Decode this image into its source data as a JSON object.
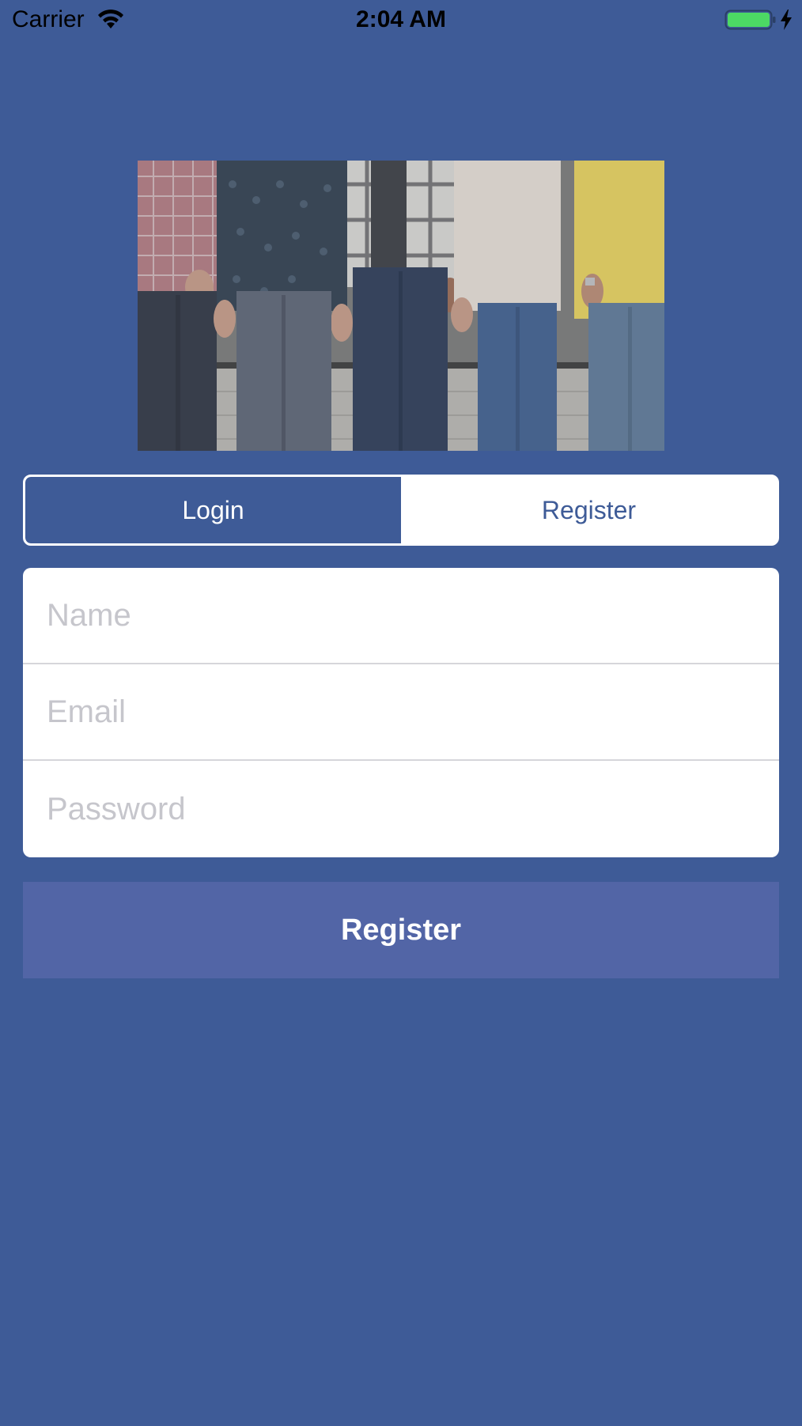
{
  "status_bar": {
    "carrier": "Carrier",
    "time": "2:04 AM",
    "battery_color": "#4cd964"
  },
  "hero": {
    "icon": "group-photo"
  },
  "tabs": {
    "login_label": "Login",
    "register_label": "Register",
    "selected": "Login"
  },
  "form": {
    "name_placeholder": "Name",
    "email_placeholder": "Email",
    "password_placeholder": "Password"
  },
  "submit": {
    "label": "Register"
  },
  "colors": {
    "background": "#3e5b97",
    "button": "#5265a6",
    "placeholder": "#c6c6cc"
  }
}
